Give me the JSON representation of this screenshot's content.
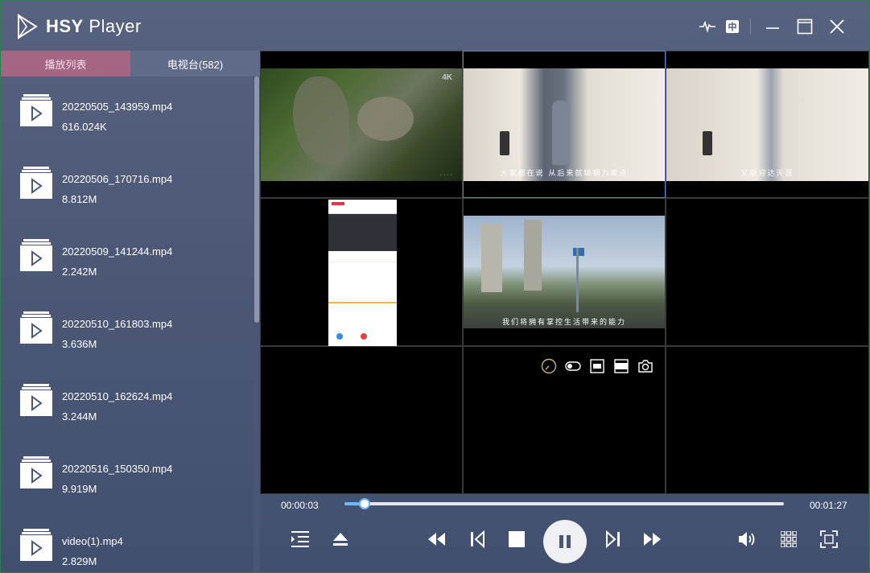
{
  "app": {
    "title_bold": "HSY",
    "title_rest": " Player",
    "lang_label": "中"
  },
  "sidebar": {
    "tabs": [
      {
        "label": "播放列表",
        "active": true
      },
      {
        "label": "电视台(582)",
        "active": false
      }
    ],
    "items": [
      {
        "name": "20220505_143959.mp4",
        "size": "616.024K"
      },
      {
        "name": "20220506_170716.mp4",
        "size": "8.812M"
      },
      {
        "name": "20220509_141244.mp4",
        "size": "2.242M"
      },
      {
        "name": "20220510_161803.mp4",
        "size": "3.636M"
      },
      {
        "name": "20220510_162624.mp4",
        "size": "3.244M"
      },
      {
        "name": "20220516_150350.mp4",
        "size": "9.919M"
      },
      {
        "name": "video(1).mp4",
        "size": "2.829M"
      }
    ]
  },
  "grid": {
    "cells": [
      {
        "badge": "4K",
        "caption": "· · · ·"
      },
      {
        "subtitle": "大家都在说   从后来就缺钢力境点"
      },
      {
        "subtitle": "又能迎达天涯"
      },
      {
        "kind": "phone-screen"
      },
      {
        "subtitle": "我们将拥有掌控生活带来的能力"
      },
      {},
      {},
      {
        "kind": "controls"
      },
      {}
    ]
  },
  "player": {
    "current_time": "00:00:03",
    "total_time": "00:01:27",
    "progress": 0.045
  },
  "colors": {
    "accent_tab": "#a56683",
    "progress": "#6fb6ff",
    "selected_border": "#5a7fc0"
  }
}
